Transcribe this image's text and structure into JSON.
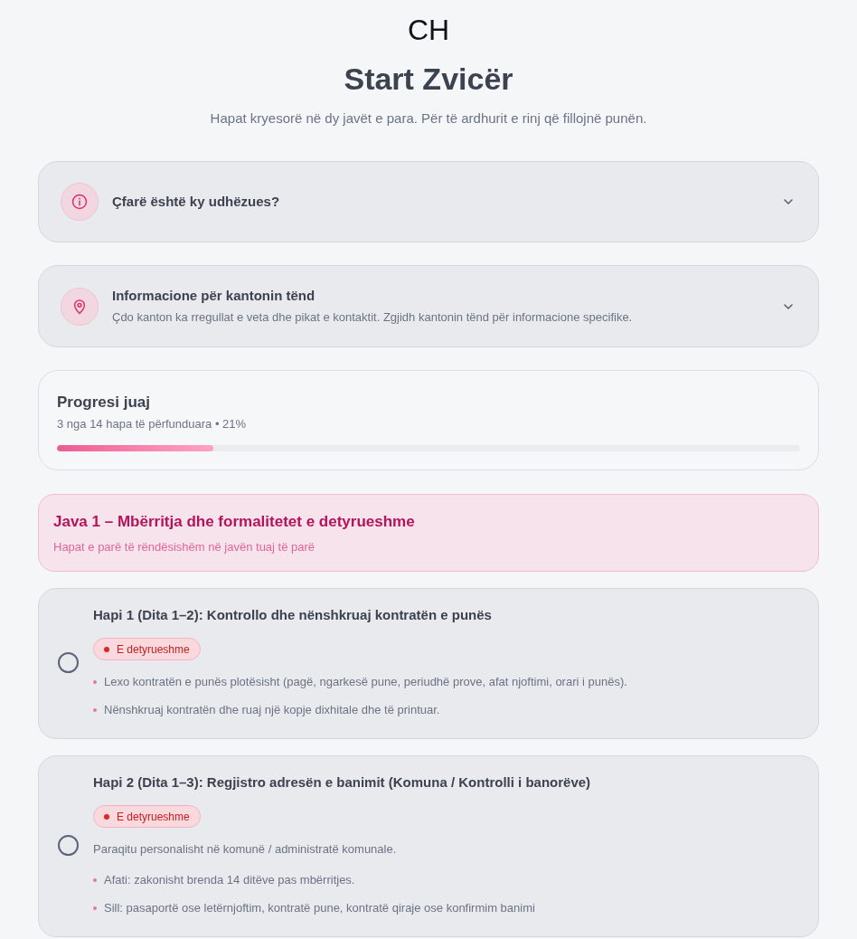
{
  "brand": "CH",
  "title": "Start Zvicër",
  "subtitle": "Hapat kryesorë në dy javët e para. Për të ardhurit e rinj që fillojnë punën.",
  "info_panels": [
    {
      "kind": "info",
      "title": "Çfarë është ky udhëzues?",
      "expanded": false
    },
    {
      "kind": "location",
      "title": "Informacione për kantonin tënd",
      "description": "Çdo kanton ka rregullat e veta dhe pikat e kontaktit. Zgjidh kantonin tënd për informacione specifike.",
      "expanded": false
    }
  ],
  "progress": {
    "title": "Progresi juaj",
    "summary": "3 nga 14 hapa të përfunduara • 21%",
    "level": 0.21
  },
  "weeks": [
    {
      "title": "Java 1 – Mbërritja dhe formalitetet e detyrueshme",
      "subtitle": "Hapat e parë të rëndësishëm në javën tuaj të parë",
      "steps": [
        {
          "title": "Hapi 1 (Dita 1–2): Kontrollo dhe nënshkruaj kontratën e punës",
          "checked": false,
          "badge": "E detyrueshme",
          "bullets": [
            "Lexo kontratën e punës plotësisht (pagë, ngarkesë pune, periudhë prove, afat njoftimi, orari i punës).",
            "Nënshkruaj kontratën dhe ruaj një kopje dixhitale dhe të printuar."
          ]
        },
        {
          "title": "Hapi 2 (Dita 1–3): Regjistro adresën e banimit (Komuna / Kontrolli i banorëve)",
          "checked": false,
          "badge": "E detyrueshme",
          "description": "Paraqitu personalisht në komunë / administratë komunale.",
          "bullets": [
            "Afati: zakonisht brenda 14 ditëve pas mbërritjes.",
            "Sill: pasaportë ose letërnjoftim, kontratë pune, kontratë qiraje ose konfirmim banimi"
          ]
        }
      ]
    }
  ]
}
